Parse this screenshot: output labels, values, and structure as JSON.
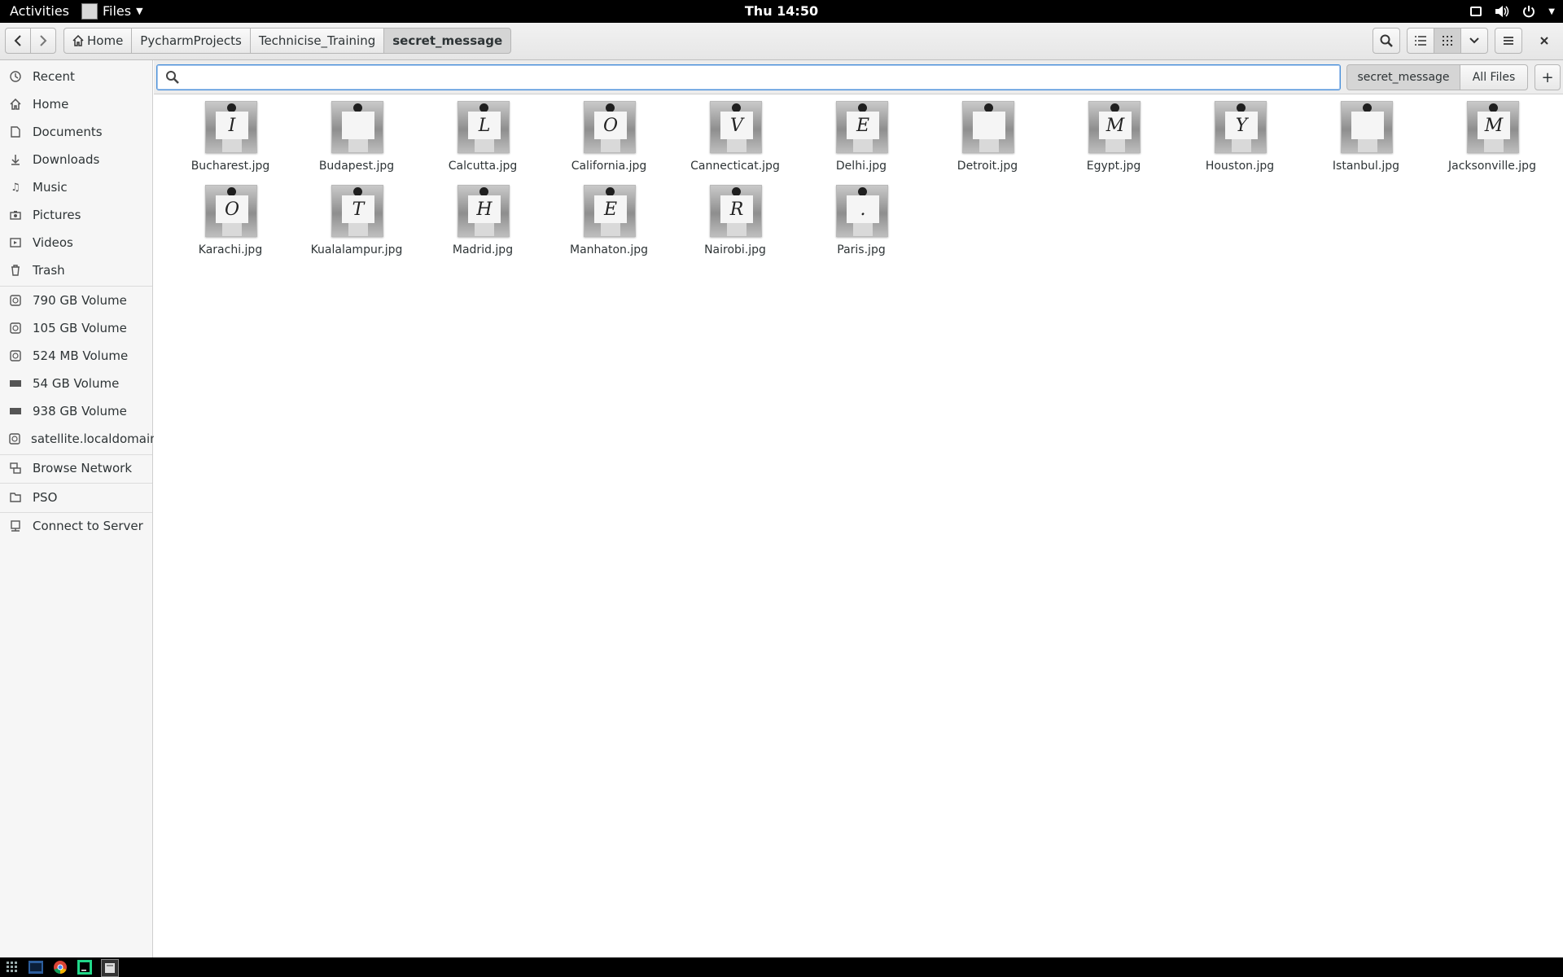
{
  "topbar": {
    "activities": "Activities",
    "app_name": "Files",
    "clock": "Thu 14:50"
  },
  "headerbar": {
    "breadcrumbs": [
      "Home",
      "PycharmProjects",
      "Technicise_Training",
      "secret_message"
    ]
  },
  "sidebar": {
    "places": [
      "Recent",
      "Home",
      "Documents",
      "Downloads",
      "Music",
      "Pictures",
      "Videos",
      "Trash"
    ],
    "devices": [
      "790 GB Volume",
      "105 GB Volume",
      "524 MB Volume",
      "54 GB Volume",
      "938 GB Volume",
      "satellite.localdomain"
    ],
    "network": [
      "Browse Network"
    ],
    "bookmarks": [
      "PSO"
    ],
    "connect": "Connect to Server"
  },
  "search": {
    "value": "",
    "placeholder": "",
    "scope_folder": "secret_message",
    "scope_all": "All Files",
    "add": "+"
  },
  "files": [
    {
      "name": "Bucharest.jpg",
      "letter": "I"
    },
    {
      "name": "Budapest.jpg",
      "letter": ""
    },
    {
      "name": "Calcutta.jpg",
      "letter": "L"
    },
    {
      "name": "California.jpg",
      "letter": "O"
    },
    {
      "name": "Cannecticat.jpg",
      "letter": "V"
    },
    {
      "name": "Delhi.jpg",
      "letter": "E"
    },
    {
      "name": "Detroit.jpg",
      "letter": ""
    },
    {
      "name": "Egypt.jpg",
      "letter": "M"
    },
    {
      "name": "Houston.jpg",
      "letter": "Y"
    },
    {
      "name": "Istanbul.jpg",
      "letter": ""
    },
    {
      "name": "Jacksonville.jpg",
      "letter": "M"
    },
    {
      "name": "Karachi.jpg",
      "letter": "O"
    },
    {
      "name": "Kualalampur.jpg",
      "letter": "T"
    },
    {
      "name": "Madrid.jpg",
      "letter": "H"
    },
    {
      "name": "Manhaton.jpg",
      "letter": "E"
    },
    {
      "name": "Nairobi.jpg",
      "letter": "R"
    },
    {
      "name": "Paris.jpg",
      "letter": "."
    }
  ]
}
